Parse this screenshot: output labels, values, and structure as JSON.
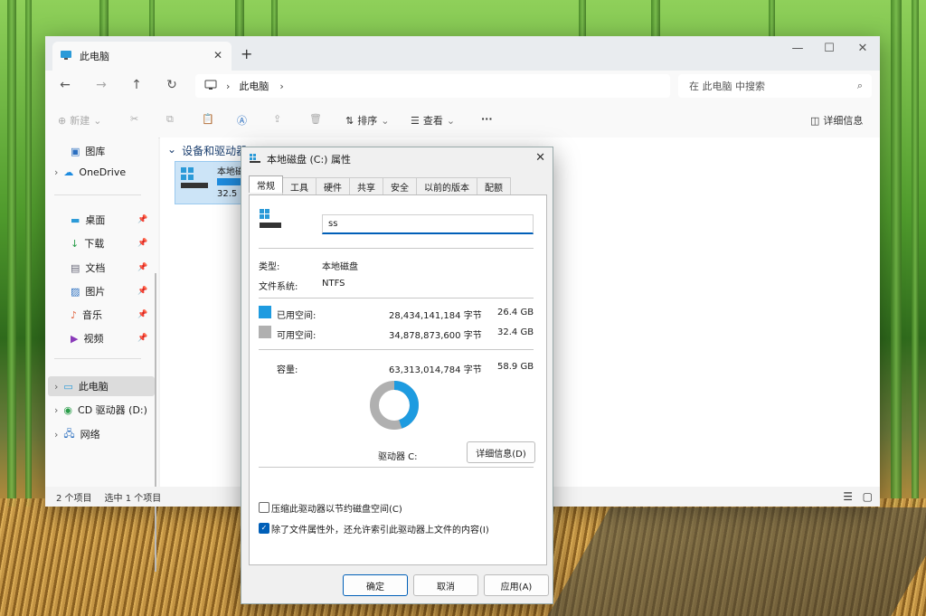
{
  "window": {
    "tab_title": "此电脑",
    "breadcrumb": [
      "此电脑"
    ],
    "search_placeholder": "在 此电脑 中搜索"
  },
  "toolbar": {
    "new_label": "新建",
    "sort_label": "排序",
    "view_label": "查看",
    "more_label": "···",
    "details_label": "详细信息"
  },
  "sidebar": {
    "items": [
      {
        "label": "图库"
      },
      {
        "label": "OneDrive"
      },
      {
        "label": "桌面"
      },
      {
        "label": "下载"
      },
      {
        "label": "文档"
      },
      {
        "label": "图片"
      },
      {
        "label": "音乐"
      },
      {
        "label": "视频"
      },
      {
        "label": "此电脑"
      },
      {
        "label": "CD 驱动器 (D:)"
      },
      {
        "label": "网络"
      }
    ]
  },
  "content": {
    "group_header": "设备和驱动器",
    "drive_name": "本地磁",
    "drive_free": "32.5 G"
  },
  "status": {
    "item_count": "2 个项目",
    "selected": "选中 1 个项目"
  },
  "dialog": {
    "title": "本地磁盘 (C:) 属性",
    "tabs": [
      "常规",
      "工具",
      "硬件",
      "共享",
      "安全",
      "以前的版本",
      "配额"
    ],
    "name_value": "ss",
    "type_label": "类型:",
    "type_value": "本地磁盘",
    "fs_label": "文件系统:",
    "fs_value": "NTFS",
    "used_label": "已用空间:",
    "used_bytes": "28,434,141,184 字节",
    "used_gb": "26.4 GB",
    "free_label": "可用空间:",
    "free_bytes": "34,878,873,600 字节",
    "free_gb": "32.4 GB",
    "cap_label": "容量:",
    "cap_bytes": "63,313,014,784 字节",
    "cap_gb": "58.9 GB",
    "drive_label": "驱动器 C:",
    "details_button": "详细信息(D)",
    "compress_label": "压缩此驱动器以节约磁盘空间(C)",
    "index_label": "除了文件属性外，还允许索引此驱动器上文件的内容(I)",
    "ok": "确定",
    "cancel": "取消",
    "apply": "应用(A)",
    "used_fraction": 0.449,
    "used_color": "#1e9be0",
    "free_color": "#b0b0b0"
  }
}
